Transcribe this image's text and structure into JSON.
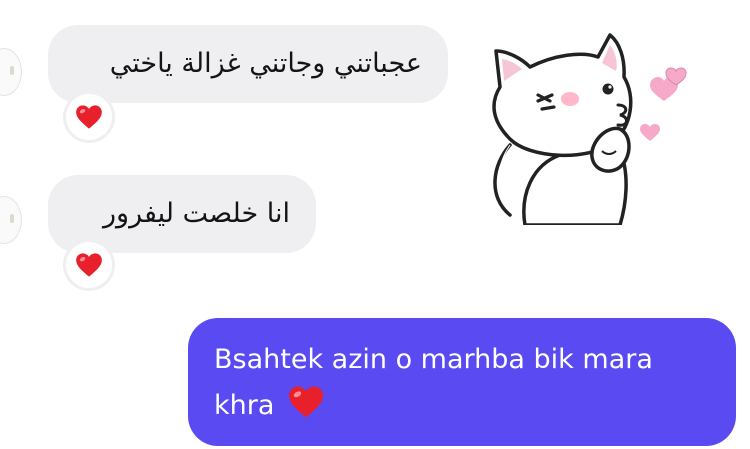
{
  "conversation": {
    "incoming": [
      {
        "text": "عجباتني وجاتني غزالة ياختي",
        "reaction": "heart"
      },
      {
        "text": "انا خلصت ليفرور",
        "reaction": "heart"
      }
    ],
    "sticker": {
      "name": "cat-blowing-kiss-sticker"
    },
    "outgoing": [
      {
        "text": "Bsahtek azin o marhba bik mara khra",
        "emoji": "heart"
      }
    ]
  },
  "colors": {
    "incoming_bubble": "#efeff2",
    "outgoing_bubble": "#5a4af2",
    "heart": "#e8202c",
    "sticker_hearts": "#f6a9c8"
  }
}
